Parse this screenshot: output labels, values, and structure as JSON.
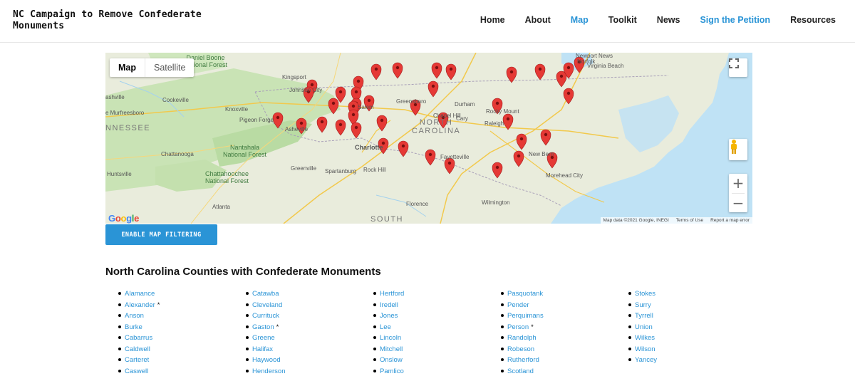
{
  "header": {
    "site_title": "NC Campaign to Remove Confederate Monuments",
    "nav": [
      {
        "label": "Home",
        "active": false
      },
      {
        "label": "About",
        "active": false
      },
      {
        "label": "Map",
        "active": true
      },
      {
        "label": "Toolkit",
        "active": false
      },
      {
        "label": "News",
        "active": false
      },
      {
        "label": "Sign the Petition",
        "active": false
      },
      {
        "label": "Resources",
        "active": false
      }
    ]
  },
  "map": {
    "type_buttons": [
      "Map",
      "Satellite"
    ],
    "selected_type": "Map",
    "zoom_in": "+",
    "zoom_out": "−",
    "logo": "Google",
    "attribution": {
      "data": "Map data ©2021 Google, INEGI",
      "terms": "Terms of Use",
      "report": "Report a map error"
    },
    "labels": {
      "daniel_boone": "Daniel Boone\nNational Forest",
      "nashville": "ashville",
      "kingsport": "Kingsport",
      "johnson_city": "Johnson City",
      "cookeville": "Cookeville",
      "murfreesboro": "e Murfreesboro",
      "knoxville": "Knoxville",
      "pigeon_forge": "Pigeon Forge",
      "tennessee": "NNESSEE",
      "asheville": "Asheville",
      "nantahala": "Nantahala\nNational Forest",
      "chattanooga": "Chattanooga",
      "chattahoochee": "Chattahoochee\nNational Forest",
      "huntsville": "Huntsville",
      "greenville": "Greenville",
      "spartanburg": "Spartanburg",
      "atlanta": "Atlanta",
      "salem": "Salem",
      "greensboro": "Greensboro",
      "durham": "Durham",
      "chapel_hill": "Chapel Hill",
      "cary": "Cary",
      "raleigh": "Raleigh",
      "north_carolina": "NORTH\nCAROLINA",
      "charlotte": "Charlotte",
      "rock_hill": "Rock Hill",
      "fayetteville": "Fayetteville",
      "florence": "Florence",
      "south": "SOUTH",
      "wilmington": "Wilmington",
      "new_bern": "New Bern",
      "morehead": "Morehead City",
      "newport_news": "Newport News",
      "norfolk": "Norfolk",
      "virginia_beach": "Virginia Beach",
      "rocky_mount": "Rocky Mount"
    },
    "markers": 48
  },
  "filter_button": "ENABLE MAP FILTERING",
  "section_title": "North Carolina Counties with Confederate Monuments",
  "counties": [
    [
      {
        "name": "Alamance",
        "note": ""
      },
      {
        "name": "Alexander",
        "note": "*"
      },
      {
        "name": "Anson",
        "note": ""
      },
      {
        "name": "Burke",
        "note": ""
      },
      {
        "name": "Cabarrus",
        "note": ""
      },
      {
        "name": "Caldwell",
        "note": ""
      },
      {
        "name": "Carteret",
        "note": ""
      },
      {
        "name": "Caswell",
        "note": ""
      }
    ],
    [
      {
        "name": "Catawba",
        "note": ""
      },
      {
        "name": "Cleveland",
        "note": ""
      },
      {
        "name": "Currituck",
        "note": ""
      },
      {
        "name": "Gaston",
        "note": "*"
      },
      {
        "name": "Greene",
        "note": ""
      },
      {
        "name": "Halifax",
        "note": ""
      },
      {
        "name": "Haywood",
        "note": ""
      },
      {
        "name": "Henderson",
        "note": ""
      }
    ],
    [
      {
        "name": "Hertford",
        "note": ""
      },
      {
        "name": "Iredell",
        "note": ""
      },
      {
        "name": "Jones",
        "note": ""
      },
      {
        "name": "Lee",
        "note": ""
      },
      {
        "name": "Lincoln",
        "note": ""
      },
      {
        "name": "Mitchell",
        "note": ""
      },
      {
        "name": "Onslow",
        "note": ""
      },
      {
        "name": "Pamlico",
        "note": ""
      }
    ],
    [
      {
        "name": "Pasquotank",
        "note": ""
      },
      {
        "name": "Pender",
        "note": ""
      },
      {
        "name": "Perquimans",
        "note": ""
      },
      {
        "name": "Person",
        "note": "*"
      },
      {
        "name": "Randolph",
        "note": ""
      },
      {
        "name": "Robeson",
        "note": ""
      },
      {
        "name": "Rutherford",
        "note": ""
      },
      {
        "name": "Scotland",
        "note": ""
      }
    ],
    [
      {
        "name": "Stokes",
        "note": ""
      },
      {
        "name": "Surry",
        "note": ""
      },
      {
        "name": "Tyrrell",
        "note": ""
      },
      {
        "name": "Union",
        "note": ""
      },
      {
        "name": "Wilkes",
        "note": ""
      },
      {
        "name": "Wilson",
        "note": ""
      },
      {
        "name": "Yancey",
        "note": ""
      }
    ]
  ],
  "colors": {
    "accent": "#2a94d6",
    "marker": "#e53935",
    "land": "#e8ecdc",
    "forest": "#c8e2b5",
    "water": "#bfe2f5"
  }
}
